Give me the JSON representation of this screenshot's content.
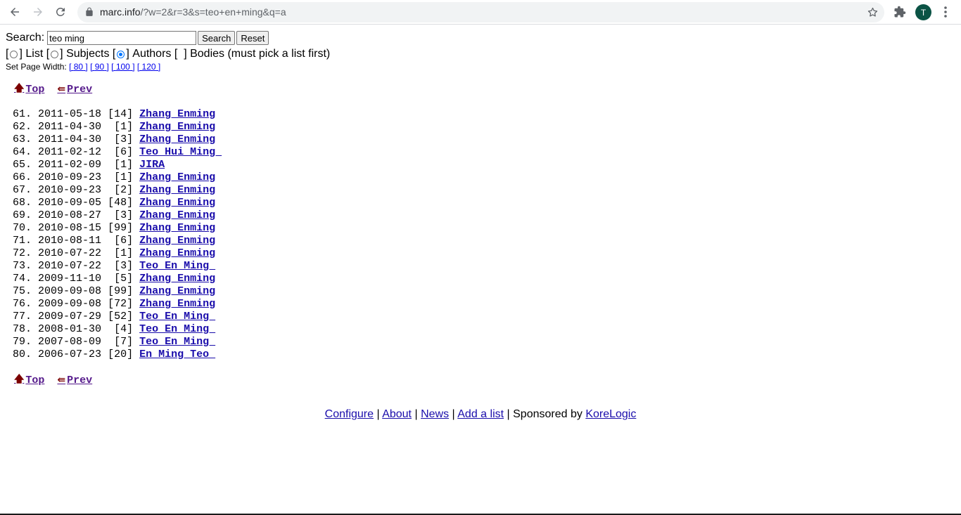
{
  "browser": {
    "url_host": "marc.info",
    "url_path": "/?w=2&r=3&s=teo+en+ming&q=a",
    "profile_initial": "T"
  },
  "search": {
    "label": "Search:",
    "value": "teo ming",
    "search_button": "Search",
    "reset_button": "Reset"
  },
  "modes": {
    "open": "[",
    "close": "]",
    "list": "List",
    "subjects": "Subjects",
    "authors": "Authors",
    "bodies": "Bodies (must pick a list first)",
    "bodies_box": "[  ]"
  },
  "page_width": {
    "label": "Set Page Width:",
    "options": [
      "80",
      "90",
      "100",
      "120"
    ]
  },
  "nav": {
    "top": "Top",
    "prev": "Prev"
  },
  "results": [
    {
      "num": "61.",
      "date": "2011-05-18",
      "count": "[14]",
      "author": "Zhang Enming"
    },
    {
      "num": "62.",
      "date": "2011-04-30",
      "count": " [1]",
      "author": "Zhang Enming"
    },
    {
      "num": "63.",
      "date": "2011-04-30",
      "count": " [3]",
      "author": "Zhang Enming"
    },
    {
      "num": "64.",
      "date": "2011-02-12",
      "count": " [6]",
      "author": "Teo Hui Ming "
    },
    {
      "num": "65.",
      "date": "2011-02-09",
      "count": " [1]",
      "author": "JIRA"
    },
    {
      "num": "66.",
      "date": "2010-09-23",
      "count": " [1]",
      "author": "Zhang Enming"
    },
    {
      "num": "67.",
      "date": "2010-09-23",
      "count": " [2]",
      "author": "Zhang Enming"
    },
    {
      "num": "68.",
      "date": "2010-09-05",
      "count": "[48]",
      "author": "Zhang Enming"
    },
    {
      "num": "69.",
      "date": "2010-08-27",
      "count": " [3]",
      "author": "Zhang Enming"
    },
    {
      "num": "70.",
      "date": "2010-08-15",
      "count": "[99]",
      "author": "Zhang Enming"
    },
    {
      "num": "71.",
      "date": "2010-08-11",
      "count": " [6]",
      "author": "Zhang Enming"
    },
    {
      "num": "72.",
      "date": "2010-07-22",
      "count": " [1]",
      "author": "Zhang Enming"
    },
    {
      "num": "73.",
      "date": "2010-07-22",
      "count": " [3]",
      "author": "Teo En Ming "
    },
    {
      "num": "74.",
      "date": "2009-11-10",
      "count": " [5]",
      "author": "Zhang Enming"
    },
    {
      "num": "75.",
      "date": "2009-09-08",
      "count": "[99]",
      "author": "Zhang Enming"
    },
    {
      "num": "76.",
      "date": "2009-09-08",
      "count": "[72]",
      "author": "Zhang Enming"
    },
    {
      "num": "77.",
      "date": "2009-07-29",
      "count": "[52]",
      "author": "Teo En Ming "
    },
    {
      "num": "78.",
      "date": "2008-01-30",
      "count": " [4]",
      "author": "Teo En Ming "
    },
    {
      "num": "79.",
      "date": "2007-08-09",
      "count": " [7]",
      "author": "Teo En Ming "
    },
    {
      "num": "80.",
      "date": "2006-07-23",
      "count": "[20]",
      "author": "En Ming Teo "
    }
  ],
  "footer": {
    "configure": "Configure",
    "about": "About",
    "news": "News",
    "add_list": "Add a list",
    "sponsored": "Sponsored by",
    "sponsor": "KoreLogic",
    "sep": "|"
  },
  "colors": {
    "link": "#1a0dab",
    "visited": "#551a8b",
    "nav_arrow": "#7b0000",
    "avatar_bg": "#0b5345"
  }
}
